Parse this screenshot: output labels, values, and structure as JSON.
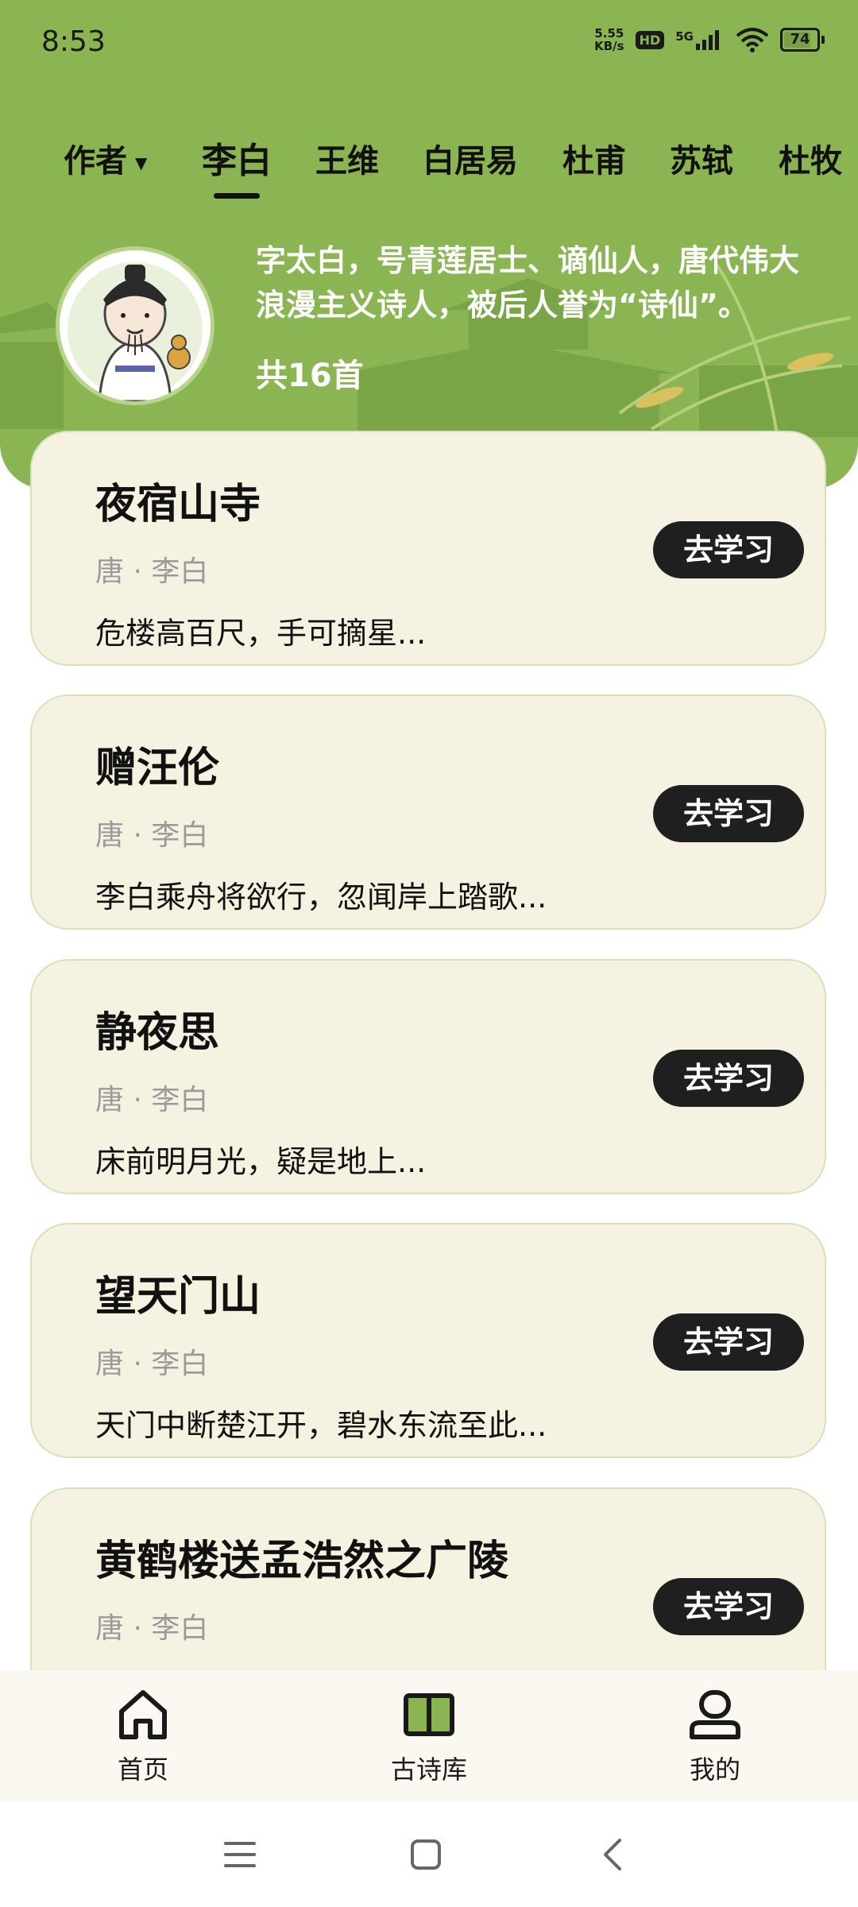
{
  "status_bar": {
    "time": "8:53",
    "net_speed_value": "5.55",
    "net_speed_unit": "KB/s",
    "hd_badge": "HD",
    "network_type": "5G",
    "battery_level": "74"
  },
  "tabs": {
    "author_label": "作者",
    "authors": [
      "李白",
      "王维",
      "白居易",
      "杜甫",
      "苏轼",
      "杜牧"
    ],
    "active_index": 0
  },
  "poet": {
    "intro": "字太白，号青莲居士、谪仙人，唐代伟大浪漫主义诗人，被后人誉为“诗仙”。",
    "count": "共16首"
  },
  "poems": [
    {
      "title": "夜宿山寺",
      "meta": "唐 · 李白",
      "excerpt": "危楼高百尺，手可摘星...",
      "button": "去学习"
    },
    {
      "title": "赠汪伦",
      "meta": "唐 · 李白",
      "excerpt": "李白乘舟将欲行，忽闻岸上踏歌...",
      "button": "去学习"
    },
    {
      "title": "静夜思",
      "meta": "唐 · 李白",
      "excerpt": "床前明月光，疑是地上...",
      "button": "去学习"
    },
    {
      "title": "望天门山",
      "meta": "唐 · 李白",
      "excerpt": "天门中断楚江开，碧水东流至此...",
      "button": "去学习"
    },
    {
      "title": "黄鹤楼送孟浩然之广陵",
      "meta": "唐 · 李白",
      "excerpt": "",
      "button": "去学习"
    }
  ],
  "bottom_nav": [
    {
      "label": "首页",
      "icon": "home-icon"
    },
    {
      "label": "古诗库",
      "icon": "book-icon"
    },
    {
      "label": "我的",
      "icon": "profile-icon"
    }
  ],
  "colors": {
    "header_green": "#8ab552",
    "card_bg": "#f6f2e1",
    "button_bg": "#1f1f1f"
  }
}
